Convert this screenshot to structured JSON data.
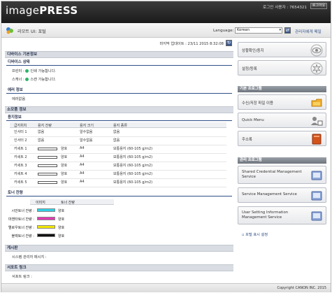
{
  "header": {
    "logo_a": "image",
    "logo_b": "PRESS",
    "login_user": "로그인 사용자 : 7654321",
    "logout_label": "로그아웃"
  },
  "subheader": {
    "title": "리모트 UI: 포털",
    "language_label": "Language:",
    "language_value": "Korean",
    "admin_link": "관리자에게 메일"
  },
  "main": {
    "updated": "마지막 업데이트 : 23/11 2015 8:32:08",
    "device_basic": "디바이스 기본정보",
    "device_status": "디바이스 상태",
    "printer_label": "프린터 :",
    "printer_status": "인쇄 가능합니다.",
    "scanner_label": "스캐너 :",
    "scanner_status": "스캔 가능합니다.",
    "error_head": "에러 정보",
    "error_text": "에러없음",
    "consumables_head": "소모품 정보",
    "paper_head": "용지정보",
    "paper_cols": [
      "급지위치",
      "용지 잔량",
      "용지 크기",
      "용지 종류"
    ],
    "paper_rows": [
      {
        "src": "인서터 1",
        "level": "없음",
        "size": "알수없음",
        "type": "없음",
        "bar": false
      },
      {
        "src": "인서터 2",
        "level": "없음",
        "size": "알수없음",
        "type": "없음",
        "bar": false
      },
      {
        "src": "카세트 1",
        "level": "양호",
        "size": "A4",
        "type": "보통용지 (60-105 g/m2)",
        "bar": true,
        "fill": 0.0
      },
      {
        "src": "카세트 2",
        "level": "양호",
        "size": "A4",
        "type": "보통용지 (60-105 g/m2)",
        "bar": true,
        "fill": 0.0
      },
      {
        "src": "카세트 3",
        "level": "양호",
        "size": "A4",
        "type": "보통용지 (60-105 g/m2)",
        "bar": true,
        "fill": 0.0
      },
      {
        "src": "카세트 4",
        "level": "양호",
        "size": "A4",
        "type": "보통용지 (60-105 g/m2)",
        "bar": true,
        "fill": 0.0
      },
      {
        "src": "카세트 5",
        "level": "양호",
        "size": "A4",
        "type": "보통용지 (60-105 g/m2)",
        "bar": true,
        "fill": 0.0
      }
    ],
    "toner_head": "토너 잔량",
    "toner_cols": [
      "이미지",
      "토너 잔량"
    ],
    "toner_rows": [
      {
        "label": "시안토너 잔량 :",
        "color": "#2fd1e6",
        "status": "양호"
      },
      {
        "label": "마젠타토너 잔량 :",
        "color": "#e23bb2",
        "status": "양호"
      },
      {
        "label": "옐로우토너 잔량 :",
        "color": "#f2e600",
        "status": "양호"
      },
      {
        "label": "블랙토너 잔량 :",
        "color": "#111111",
        "status": "양호"
      }
    ],
    "board_head": "게시판",
    "board_text": "시스템 관리자 메시지 :",
    "support_head": "서포트 링크",
    "support_text": "서포트 링크 :"
  },
  "side": {
    "btn_status": "상황확인/중지",
    "btn_settings": "설정/등록",
    "basic_head": "기본 프로그램",
    "btn_box": "수신/저장 파일 이용",
    "btn_quick": "Quick Menu",
    "btn_address": "주소록",
    "mgmt_head": "관리 프로그램",
    "btn_shared": "Shared Credential Management Service",
    "btn_svc": "Service Management Service",
    "btn_user": "User Setting Information Management Service",
    "portal_setting": "포털 표시 설정"
  },
  "footer": {
    "copyright": "Copyright CANON INC. 2015"
  },
  "colors": {
    "accent": "#2e4f88",
    "status_ok": "#2fb36a"
  }
}
